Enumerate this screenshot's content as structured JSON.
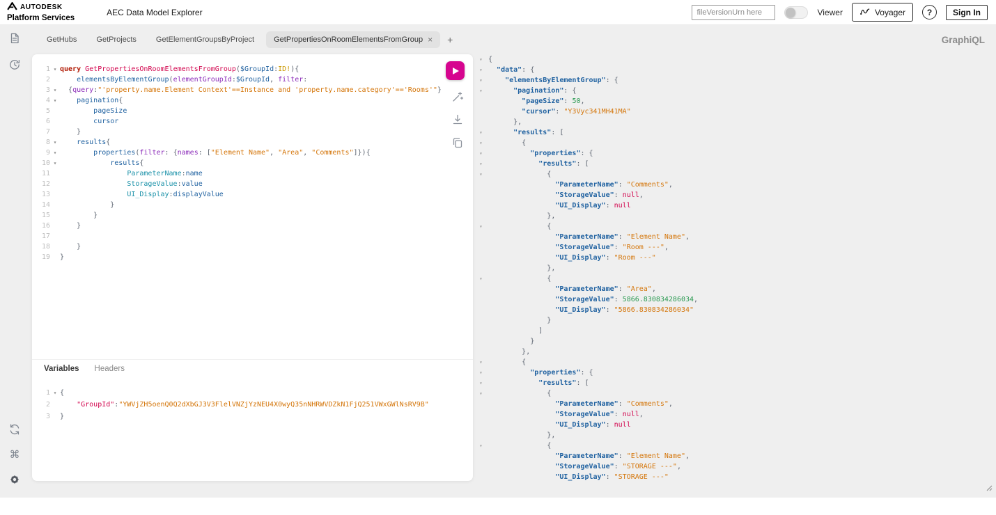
{
  "header": {
    "brand_line1": "AUTODESK",
    "brand_line2": "Platform Services",
    "app_title": "AEC Data Model Explorer",
    "urn_placeholder": "fileVersionUrn here",
    "viewer_label": "Viewer",
    "voyager_label": "Voyager",
    "help_glyph": "?",
    "signin_label": "Sign In"
  },
  "accent_color": "#d6058f",
  "icons": {
    "shortcut_glyph": "⌘"
  },
  "tabbar": {
    "tabs": [
      {
        "label": "GetHubs",
        "active": false
      },
      {
        "label": "GetProjects",
        "active": false
      },
      {
        "label": "GetElementGroupsByProject",
        "active": false
      },
      {
        "label": "GetPropertiesOnRoomElementsFromGroup",
        "active": true
      }
    ],
    "add_glyph": "+",
    "close_glyph": "×",
    "logo": "GraphiQL"
  },
  "editor": {
    "fold_glyph": "▾",
    "query_lines": [
      {
        "n": 1,
        "f": true,
        "t": [
          [
            "kw",
            "query"
          ],
          [
            "pln",
            " "
          ],
          [
            "def",
            "GetPropertiesOnRoomElementsFromGroup"
          ],
          [
            "pun",
            "("
          ],
          [
            "var",
            "$GroupId"
          ],
          [
            "pun",
            ":"
          ],
          [
            "typ",
            "ID!"
          ],
          [
            "pun",
            "){"
          ]
        ]
      },
      {
        "n": 2,
        "t": [
          [
            "pln",
            "    "
          ],
          [
            "prop",
            "elementsByElementGroup"
          ],
          [
            "pun",
            "("
          ],
          [
            "attr",
            "elementGroupId"
          ],
          [
            "pun",
            ":"
          ],
          [
            "var",
            "$GroupId"
          ],
          [
            "pun",
            ", "
          ],
          [
            "attr",
            "filter"
          ],
          [
            "pun",
            ":"
          ]
        ]
      },
      {
        "n": 3,
        "f": true,
        "t": [
          [
            "pln",
            "  "
          ],
          [
            "pun",
            "{"
          ],
          [
            "attr",
            "query"
          ],
          [
            "pun",
            ":"
          ],
          [
            "str",
            "\"'property.name.Element Context'==Instance and 'property.name.category'=='Rooms'\""
          ],
          [
            "pun",
            "}"
          ]
        ]
      },
      {
        "n": 4,
        "f": true,
        "t": [
          [
            "pln",
            "    "
          ],
          [
            "prop",
            "pagination"
          ],
          [
            "pun",
            "{"
          ]
        ]
      },
      {
        "n": 5,
        "t": [
          [
            "pln",
            "        "
          ],
          [
            "prop",
            "pageSize"
          ]
        ]
      },
      {
        "n": 6,
        "t": [
          [
            "pln",
            "        "
          ],
          [
            "prop",
            "cursor"
          ]
        ]
      },
      {
        "n": 7,
        "t": [
          [
            "pln",
            "    "
          ],
          [
            "pun",
            "}"
          ]
        ]
      },
      {
        "n": 8,
        "f": true,
        "t": [
          [
            "pln",
            "    "
          ],
          [
            "prop",
            "results"
          ],
          [
            "pun",
            "{"
          ]
        ]
      },
      {
        "n": 9,
        "f": true,
        "t": [
          [
            "pln",
            "        "
          ],
          [
            "prop",
            "properties"
          ],
          [
            "pun",
            "("
          ],
          [
            "attr",
            "filter"
          ],
          [
            "pun",
            ": {"
          ],
          [
            "attr",
            "names"
          ],
          [
            "pun",
            ": ["
          ],
          [
            "str",
            "\"Element Name\""
          ],
          [
            "pun",
            ", "
          ],
          [
            "str",
            "\"Area\""
          ],
          [
            "pun",
            ", "
          ],
          [
            "str",
            "\"Comments\""
          ],
          [
            "pun",
            "]}){"
          ]
        ]
      },
      {
        "n": 10,
        "f": true,
        "t": [
          [
            "pln",
            "            "
          ],
          [
            "prop",
            "results"
          ],
          [
            "pun",
            "{"
          ]
        ]
      },
      {
        "n": 11,
        "t": [
          [
            "pln",
            "                "
          ],
          [
            "ali",
            "ParameterName"
          ],
          [
            "pun",
            ":"
          ],
          [
            "prop",
            "name"
          ]
        ]
      },
      {
        "n": 12,
        "t": [
          [
            "pln",
            "                "
          ],
          [
            "ali",
            "StorageValue"
          ],
          [
            "pun",
            ":"
          ],
          [
            "prop",
            "value"
          ]
        ]
      },
      {
        "n": 13,
        "t": [
          [
            "pln",
            "                "
          ],
          [
            "ali",
            "UI_Display"
          ],
          [
            "pun",
            ":"
          ],
          [
            "prop",
            "displayValue"
          ]
        ]
      },
      {
        "n": 14,
        "t": [
          [
            "pln",
            "            "
          ],
          [
            "pun",
            "}"
          ]
        ]
      },
      {
        "n": 15,
        "t": [
          [
            "pln",
            "        "
          ],
          [
            "pun",
            "}"
          ]
        ]
      },
      {
        "n": 16,
        "t": [
          [
            "pln",
            "    "
          ],
          [
            "pun",
            "}"
          ]
        ]
      },
      {
        "n": 17,
        "t": []
      },
      {
        "n": 18,
        "t": [
          [
            "pln",
            "    "
          ],
          [
            "pun",
            "}"
          ]
        ]
      },
      {
        "n": 19,
        "t": [
          [
            "pun",
            "}"
          ]
        ]
      }
    ],
    "secondary_tabs": [
      {
        "label": "Variables",
        "active": true
      },
      {
        "label": "Headers",
        "active": false
      }
    ],
    "variable_lines": [
      {
        "n": 1,
        "f": true,
        "t": [
          [
            "pun",
            "{"
          ]
        ]
      },
      {
        "n": 2,
        "t": [
          [
            "pln",
            "    "
          ],
          [
            "vkey",
            "\"GroupId\""
          ],
          [
            "pun",
            ":"
          ],
          [
            "str",
            "\"YWVjZH5oenQ0Q2dXbGJ3V3FlelVNZjYzNEU4X0wyQ35nNHRWVDZkN1FjQ251VWxGWlNsRV9B\""
          ]
        ]
      },
      {
        "n": 3,
        "t": [
          [
            "pun",
            "}"
          ]
        ]
      }
    ]
  },
  "response": {
    "lines": [
      {
        "f": true,
        "t": [
          [
            "pun",
            "{"
          ]
        ]
      },
      {
        "f": true,
        "t": [
          [
            "pln",
            "  "
          ],
          [
            "key",
            "\"data\""
          ],
          [
            "pun",
            ": {"
          ]
        ]
      },
      {
        "f": true,
        "t": [
          [
            "pln",
            "    "
          ],
          [
            "key",
            "\"elementsByElementGroup\""
          ],
          [
            "pun",
            ": {"
          ]
        ]
      },
      {
        "f": true,
        "t": [
          [
            "pln",
            "      "
          ],
          [
            "key",
            "\"pagination\""
          ],
          [
            "pun",
            ": {"
          ]
        ]
      },
      {
        "t": [
          [
            "pln",
            "        "
          ],
          [
            "key",
            "\"pageSize\""
          ],
          [
            "pun",
            ": "
          ],
          [
            "num",
            "50"
          ],
          [
            "pun",
            ","
          ]
        ]
      },
      {
        "t": [
          [
            "pln",
            "        "
          ],
          [
            "key",
            "\"cursor\""
          ],
          [
            "pun",
            ": "
          ],
          [
            "str",
            "\"Y3Vyc341MH41MA\""
          ]
        ]
      },
      {
        "t": [
          [
            "pln",
            "      "
          ],
          [
            "pun",
            "},"
          ]
        ]
      },
      {
        "f": true,
        "t": [
          [
            "pln",
            "      "
          ],
          [
            "key",
            "\"results\""
          ],
          [
            "pun",
            ": ["
          ]
        ]
      },
      {
        "f": true,
        "t": [
          [
            "pln",
            "        "
          ],
          [
            "pun",
            "{"
          ]
        ]
      },
      {
        "f": true,
        "t": [
          [
            "pln",
            "          "
          ],
          [
            "key",
            "\"properties\""
          ],
          [
            "pun",
            ": {"
          ]
        ]
      },
      {
        "f": true,
        "t": [
          [
            "pln",
            "            "
          ],
          [
            "key",
            "\"results\""
          ],
          [
            "pun",
            ": ["
          ]
        ]
      },
      {
        "f": true,
        "t": [
          [
            "pln",
            "              "
          ],
          [
            "pun",
            "{"
          ]
        ]
      },
      {
        "t": [
          [
            "pln",
            "                "
          ],
          [
            "key",
            "\"ParameterName\""
          ],
          [
            "pun",
            ": "
          ],
          [
            "str",
            "\"Comments\""
          ],
          [
            "pun",
            ","
          ]
        ]
      },
      {
        "t": [
          [
            "pln",
            "                "
          ],
          [
            "key",
            "\"StorageValue\""
          ],
          [
            "pun",
            ": "
          ],
          [
            "nul",
            "null"
          ],
          [
            "pun",
            ","
          ]
        ]
      },
      {
        "t": [
          [
            "pln",
            "                "
          ],
          [
            "key",
            "\"UI_Display\""
          ],
          [
            "pun",
            ": "
          ],
          [
            "nul",
            "null"
          ]
        ]
      },
      {
        "t": [
          [
            "pln",
            "              "
          ],
          [
            "pun",
            "},"
          ]
        ]
      },
      {
        "f": true,
        "t": [
          [
            "pln",
            "              "
          ],
          [
            "pun",
            "{"
          ]
        ]
      },
      {
        "t": [
          [
            "pln",
            "                "
          ],
          [
            "key",
            "\"ParameterName\""
          ],
          [
            "pun",
            ": "
          ],
          [
            "str",
            "\"Element Name\""
          ],
          [
            "pun",
            ","
          ]
        ]
      },
      {
        "t": [
          [
            "pln",
            "                "
          ],
          [
            "key",
            "\"StorageValue\""
          ],
          [
            "pun",
            ": "
          ],
          [
            "str",
            "\"Room ---\""
          ],
          [
            "pun",
            ","
          ]
        ]
      },
      {
        "t": [
          [
            "pln",
            "                "
          ],
          [
            "key",
            "\"UI_Display\""
          ],
          [
            "pun",
            ": "
          ],
          [
            "str",
            "\"Room ---\""
          ]
        ]
      },
      {
        "t": [
          [
            "pln",
            "              "
          ],
          [
            "pun",
            "},"
          ]
        ]
      },
      {
        "f": true,
        "t": [
          [
            "pln",
            "              "
          ],
          [
            "pun",
            "{"
          ]
        ]
      },
      {
        "t": [
          [
            "pln",
            "                "
          ],
          [
            "key",
            "\"ParameterName\""
          ],
          [
            "pun",
            ": "
          ],
          [
            "str",
            "\"Area\""
          ],
          [
            "pun",
            ","
          ]
        ]
      },
      {
        "t": [
          [
            "pln",
            "                "
          ],
          [
            "key",
            "\"StorageValue\""
          ],
          [
            "pun",
            ": "
          ],
          [
            "num",
            "5866.830834286034"
          ],
          [
            "pun",
            ","
          ]
        ]
      },
      {
        "t": [
          [
            "pln",
            "                "
          ],
          [
            "key",
            "\"UI_Display\""
          ],
          [
            "pun",
            ": "
          ],
          [
            "str",
            "\"5866.830834286034\""
          ]
        ]
      },
      {
        "t": [
          [
            "pln",
            "              "
          ],
          [
            "pun",
            "}"
          ]
        ]
      },
      {
        "t": [
          [
            "pln",
            "            "
          ],
          [
            "pun",
            "]"
          ]
        ]
      },
      {
        "t": [
          [
            "pln",
            "          "
          ],
          [
            "pun",
            "}"
          ]
        ]
      },
      {
        "t": [
          [
            "pln",
            "        "
          ],
          [
            "pun",
            "},"
          ]
        ]
      },
      {
        "f": true,
        "t": [
          [
            "pln",
            "        "
          ],
          [
            "pun",
            "{"
          ]
        ]
      },
      {
        "f": true,
        "t": [
          [
            "pln",
            "          "
          ],
          [
            "key",
            "\"properties\""
          ],
          [
            "pun",
            ": {"
          ]
        ]
      },
      {
        "f": true,
        "t": [
          [
            "pln",
            "            "
          ],
          [
            "key",
            "\"results\""
          ],
          [
            "pun",
            ": ["
          ]
        ]
      },
      {
        "f": true,
        "t": [
          [
            "pln",
            "              "
          ],
          [
            "pun",
            "{"
          ]
        ]
      },
      {
        "t": [
          [
            "pln",
            "                "
          ],
          [
            "key",
            "\"ParameterName\""
          ],
          [
            "pun",
            ": "
          ],
          [
            "str",
            "\"Comments\""
          ],
          [
            "pun",
            ","
          ]
        ]
      },
      {
        "t": [
          [
            "pln",
            "                "
          ],
          [
            "key",
            "\"StorageValue\""
          ],
          [
            "pun",
            ": "
          ],
          [
            "nul",
            "null"
          ],
          [
            "pun",
            ","
          ]
        ]
      },
      {
        "t": [
          [
            "pln",
            "                "
          ],
          [
            "key",
            "\"UI_Display\""
          ],
          [
            "pun",
            ": "
          ],
          [
            "nul",
            "null"
          ]
        ]
      },
      {
        "t": [
          [
            "pln",
            "              "
          ],
          [
            "pun",
            "},"
          ]
        ]
      },
      {
        "f": true,
        "t": [
          [
            "pln",
            "              "
          ],
          [
            "pun",
            "{"
          ]
        ]
      },
      {
        "t": [
          [
            "pln",
            "                "
          ],
          [
            "key",
            "\"ParameterName\""
          ],
          [
            "pun",
            ": "
          ],
          [
            "str",
            "\"Element Name\""
          ],
          [
            "pun",
            ","
          ]
        ]
      },
      {
        "t": [
          [
            "pln",
            "                "
          ],
          [
            "key",
            "\"StorageValue\""
          ],
          [
            "pun",
            ": "
          ],
          [
            "str",
            "\"STORAGE ---\""
          ],
          [
            "pun",
            ","
          ]
        ]
      },
      {
        "t": [
          [
            "pln",
            "                "
          ],
          [
            "key",
            "\"UI_Display\""
          ],
          [
            "pun",
            ": "
          ],
          [
            "str",
            "\"STORAGE ---\""
          ]
        ]
      }
    ]
  }
}
